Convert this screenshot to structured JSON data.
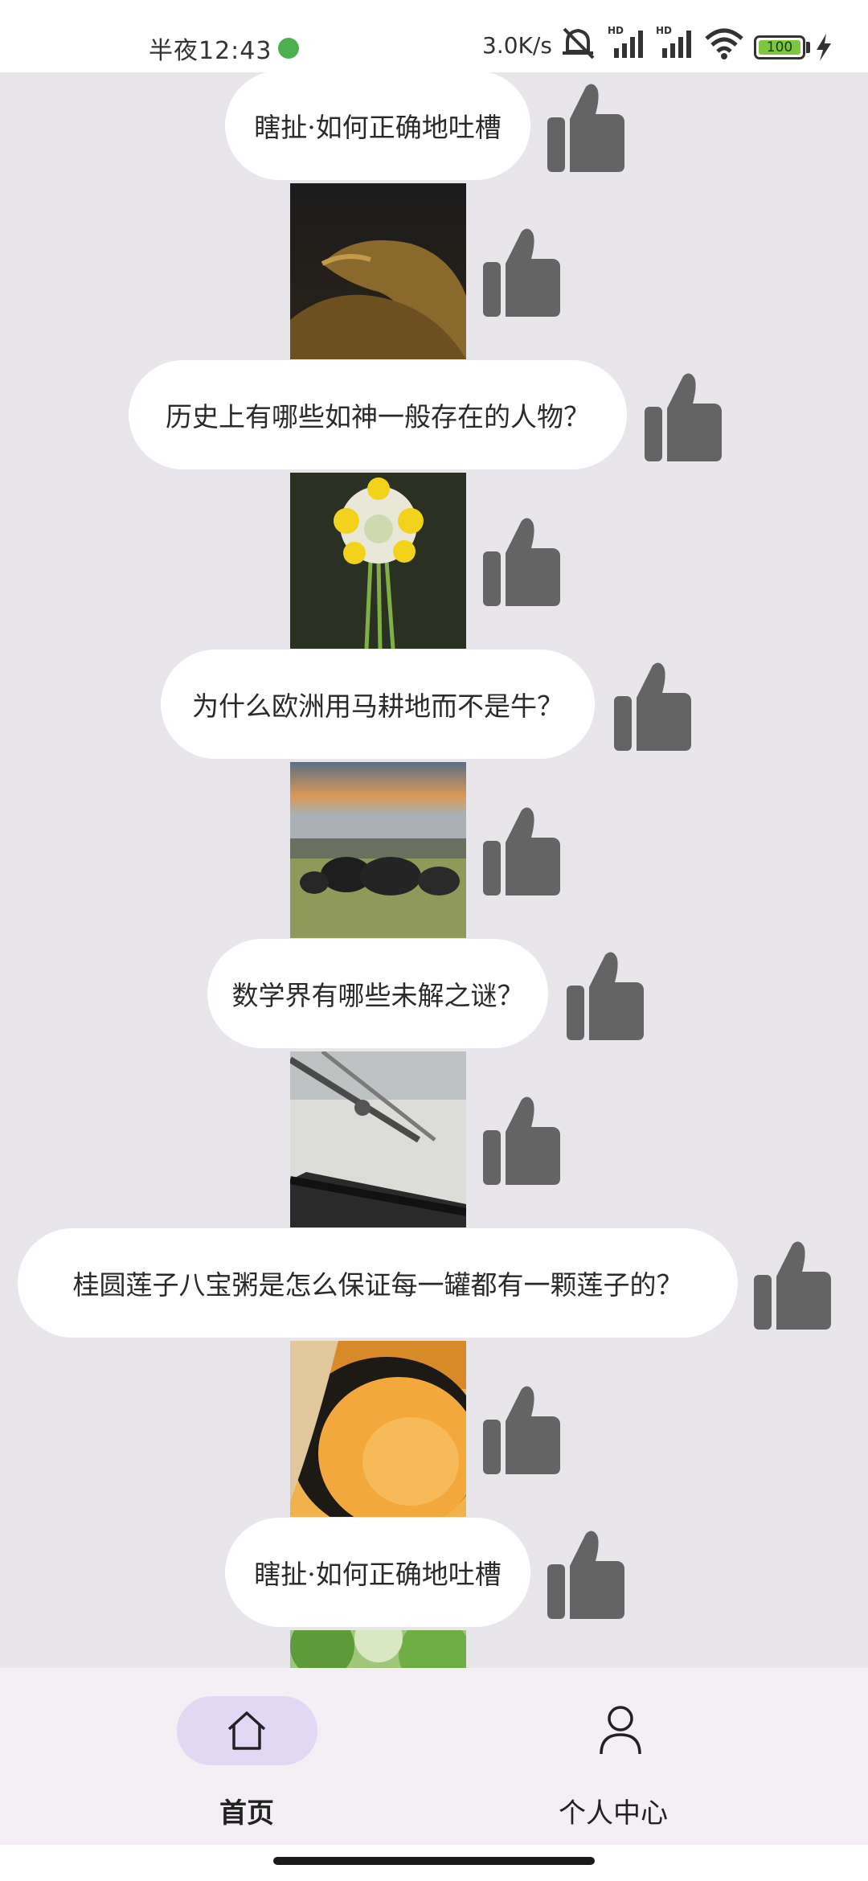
{
  "status_bar": {
    "time": "半夜12:43",
    "net_speed": "3.0K/s",
    "battery": "100",
    "battery_level": 1.0
  },
  "feed": [
    {
      "type": "question",
      "text": "瞎扯·如何正确地吐槽"
    },
    {
      "type": "image",
      "icon": "snake-photo"
    },
    {
      "type": "question",
      "text": "历史上有哪些如神一般存在的人物？"
    },
    {
      "type": "image",
      "icon": "yellow-flower-photo"
    },
    {
      "type": "question",
      "text": "为什么欧洲用马耕地而不是牛？"
    },
    {
      "type": "image",
      "icon": "buffalo-field-photo"
    },
    {
      "type": "question",
      "text": "数学界有哪些未解之谜？"
    },
    {
      "type": "image",
      "icon": "drafting-tools-photo"
    },
    {
      "type": "question",
      "text": "桂圆莲子八宝粥是怎么保证每一罐都有一颗莲子的？"
    },
    {
      "type": "image",
      "icon": "porridge-spoon-photo"
    },
    {
      "type": "question",
      "text": "瞎扯·如何正确地吐槽"
    },
    {
      "type": "image",
      "icon": "green-tree-photo"
    }
  ],
  "bottom_nav": {
    "items": [
      {
        "label": "首页",
        "icon": "home-icon",
        "active": true
      },
      {
        "label": "个人中心",
        "icon": "person-icon",
        "active": false
      }
    ]
  },
  "colors": {
    "background": "#e8e6ea",
    "pill": "#ffffff",
    "thumb": "#646464",
    "nav_active": "#e3d8f3"
  }
}
